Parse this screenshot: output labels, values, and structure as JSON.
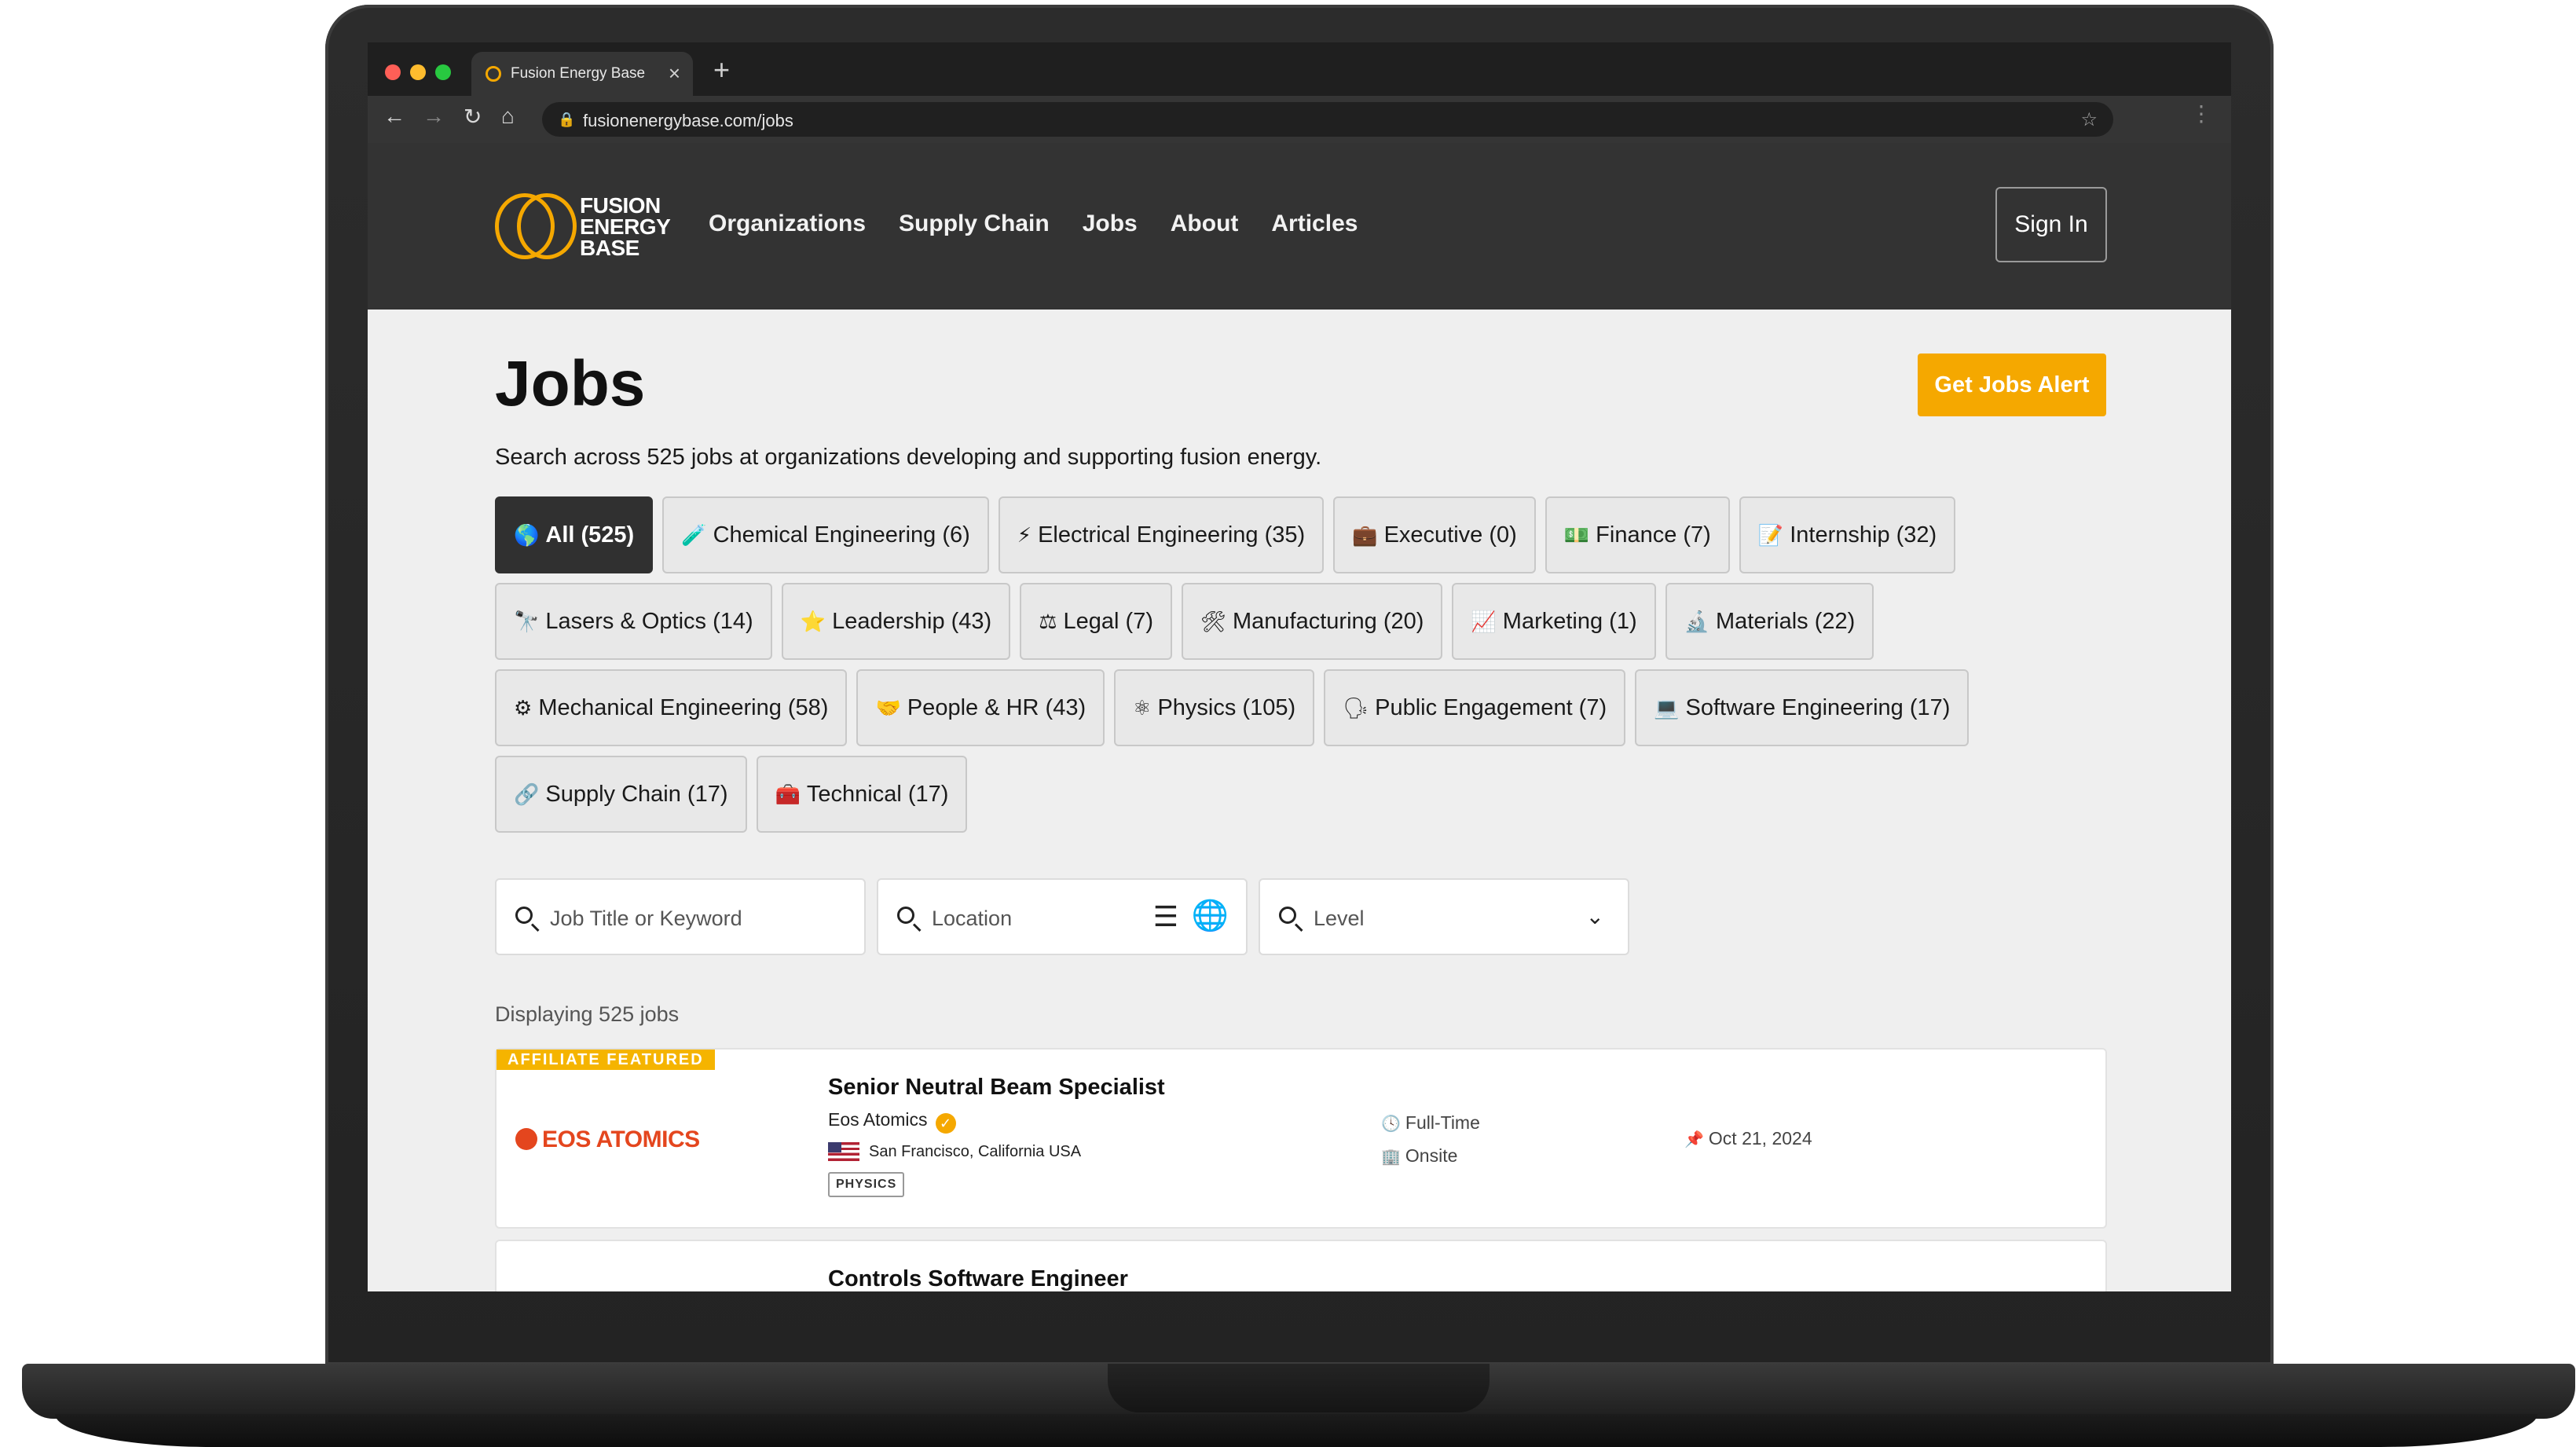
{
  "browser": {
    "tab_title": "Fusion Energy Base",
    "url": "fusionenergybase.com/jobs"
  },
  "site": {
    "logo_text": "FUSION\nENERGY\nBASE",
    "nav": [
      "Organizations",
      "Supply Chain",
      "Jobs",
      "About",
      "Articles"
    ],
    "sign_in": "Sign In"
  },
  "page": {
    "title": "Jobs",
    "alert_button": "Get Jobs Alert",
    "subtitle": "Search across 525 jobs at organizations developing and supporting fusion energy.",
    "categories": [
      [
        {
          "icon": "🌎",
          "label": "All (525)",
          "active": true
        },
        {
          "icon": "🧪",
          "label": "Chemical Engineering (6)"
        },
        {
          "icon": "⚡",
          "label": "Electrical Engineering (35)"
        },
        {
          "icon": "💼",
          "label": "Executive (0)"
        },
        {
          "icon": "💵",
          "label": "Finance (7)"
        },
        {
          "icon": "📝",
          "label": "Internship (32)"
        }
      ],
      [
        {
          "icon": "🔭",
          "label": "Lasers & Optics (14)"
        },
        {
          "icon": "⭐",
          "label": "Leadership (43)"
        },
        {
          "icon": "⚖",
          "label": "Legal (7)"
        },
        {
          "icon": "🛠",
          "label": "Manufacturing (20)"
        },
        {
          "icon": "📈",
          "label": "Marketing (1)"
        },
        {
          "icon": "🔬",
          "label": "Materials (22)"
        }
      ],
      [
        {
          "icon": "⚙",
          "label": "Mechanical Engineering (58)"
        },
        {
          "icon": "🤝",
          "label": "People & HR (43)"
        },
        {
          "icon": "⚛",
          "label": "Physics (105)"
        },
        {
          "icon": "🗣",
          "label": "Public Engagement (7)"
        },
        {
          "icon": "💻",
          "label": "Software Engineering (17)"
        }
      ],
      [
        {
          "icon": "🔗",
          "label": "Supply Chain (17)"
        },
        {
          "icon": "🧰",
          "label": "Technical (17)"
        }
      ]
    ],
    "filters": {
      "keyword_placeholder": "Job Title or Keyword",
      "location_placeholder": "Location",
      "level_placeholder": "Level"
    },
    "count_text": "Displaying 525 jobs",
    "jobs": [
      {
        "ribbon": "AFFILIATE FEATURED",
        "company_logo": "EOS ATOMICS",
        "title": "Senior Neutral Beam Specialist",
        "company": "Eos Atomics",
        "location": "San Francisco, California USA",
        "tag": "PHYSICS",
        "type": "Full-Time",
        "mode": "Onsite",
        "date": "Oct 21, 2024"
      },
      {
        "title": "Controls Software Engineer"
      }
    ]
  },
  "colors": {
    "accent": "#f5a800",
    "header_bg": "#333333",
    "page_bg": "#efefef",
    "eos_red": "#e4461e"
  }
}
